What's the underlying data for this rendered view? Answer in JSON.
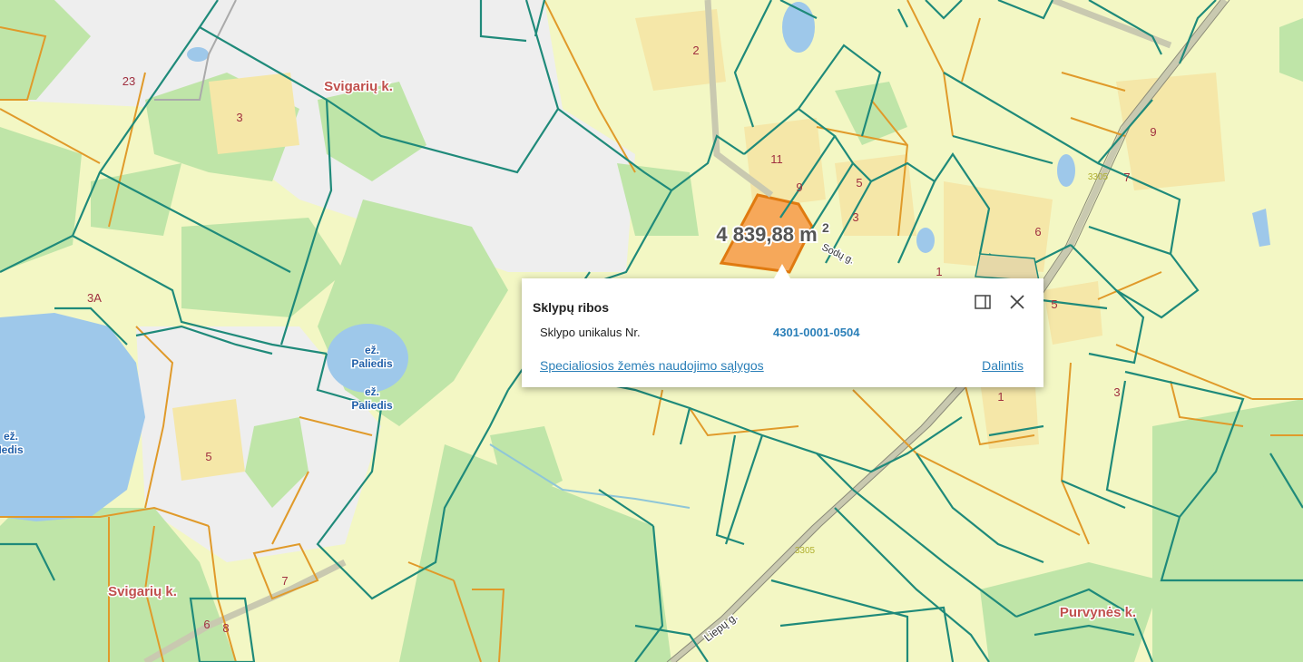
{
  "map": {
    "area_label": "4 839,88 m",
    "area_sup": "2",
    "villages": [
      "Svigarių k.",
      "Svigarių k.",
      "Purvynės k."
    ],
    "lakes": [
      {
        "line1": "ež.",
        "line2": "Paliedis"
      },
      {
        "line1": "ež.",
        "line2": "Paliedis"
      },
      {
        "line1": "ež.",
        "line2": "Iedis"
      }
    ],
    "streets": [
      "Liepų g.",
      "Sodų g."
    ],
    "roads": [
      "3305",
      "3305"
    ],
    "numbers": [
      "23",
      "3",
      "2",
      "11",
      "9",
      "5",
      "3",
      "6",
      "9",
      "7",
      "1",
      "3A",
      "5",
      "1",
      "3",
      "5",
      "7",
      "6",
      "8"
    ],
    "colors": {
      "parcel_teal": "#1f8a7a",
      "parcel_orange": "#e09a2a",
      "selected_fill": "#f6a85a",
      "water": "#9ec8ea",
      "forest": "#bfe5a8",
      "field": "#f3f7c4"
    }
  },
  "popup": {
    "title": "Sklypų ribos",
    "label": "Sklypo unikalus Nr.",
    "value": "4301-0001-0504",
    "link": "Specialiosios žemės naudojimo sąlygos",
    "share": "Dalintis",
    "dock_icon": "dock-panel-icon",
    "close_icon": "close-icon"
  }
}
